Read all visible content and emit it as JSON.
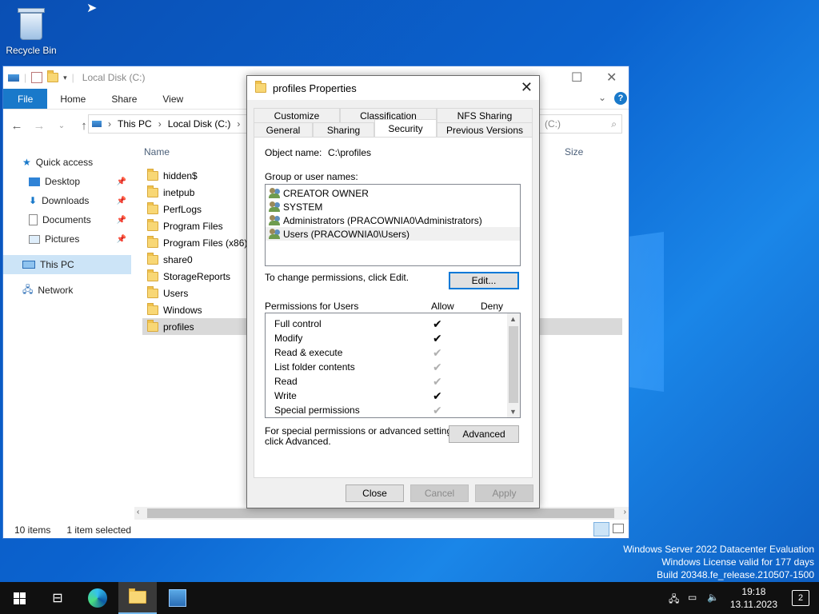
{
  "desktop": {
    "recycle_bin_label": "Recycle Bin",
    "watermark": [
      "Windows Server 2022 Datacenter Evaluation",
      "Windows License valid for 177 days",
      "Build 20348.fe_release.210507-1500"
    ]
  },
  "explorer": {
    "title": "Local Disk (C:)",
    "ribbon_tabs": [
      "File",
      "Home",
      "Share",
      "View"
    ],
    "address": {
      "segments": [
        "This PC",
        "Local Disk (C:)"
      ],
      "search_fragment": "(C:)"
    },
    "nav_pane": {
      "quick_access": "Quick access",
      "items": [
        "Desktop",
        "Downloads",
        "Documents",
        "Pictures"
      ],
      "this_pc": "This PC",
      "network": "Network"
    },
    "columns": {
      "name": "Name",
      "size": "Size"
    },
    "files": [
      "hidden$",
      "inetpub",
      "PerfLogs",
      "Program Files",
      "Program Files (x86)",
      "share0",
      "StorageReports",
      "Users",
      "Windows",
      "profiles"
    ],
    "status": {
      "count": "10 items",
      "selected": "1 item selected"
    }
  },
  "dialog": {
    "title": "profiles Properties",
    "tabs_top": [
      "Customize",
      "Classification",
      "NFS Sharing"
    ],
    "tabs_bottom": [
      "General",
      "Sharing",
      "Security",
      "Previous Versions"
    ],
    "object_name_label": "Object name:",
    "object_name_value": "C:\\profiles",
    "group_label": "Group or user names:",
    "users": [
      "CREATOR OWNER",
      "SYSTEM",
      "Administrators (PRACOWNIA0\\Administrators)",
      "Users (PRACOWNIA0\\Users)"
    ],
    "change_hint": "To change permissions, click Edit.",
    "edit_button": "Edit...",
    "permissions_label": "Permissions for Users",
    "allow_label": "Allow",
    "deny_label": "Deny",
    "permissions": [
      {
        "name": "Full control",
        "allow": "black"
      },
      {
        "name": "Modify",
        "allow": "black"
      },
      {
        "name": "Read & execute",
        "allow": "grey"
      },
      {
        "name": "List folder contents",
        "allow": "grey"
      },
      {
        "name": "Read",
        "allow": "grey"
      },
      {
        "name": "Write",
        "allow": "black"
      },
      {
        "name": "Special permissions",
        "allow": "grey"
      }
    ],
    "advanced_hint_1": "For special permissions or advanced settings,",
    "advanced_hint_2": "click Advanced.",
    "advanced_button": "Advanced",
    "close_button": "Close",
    "cancel_button": "Cancel",
    "apply_button": "Apply"
  },
  "taskbar": {
    "time": "19:18",
    "date": "13.11.2023",
    "notification_count": "2"
  }
}
